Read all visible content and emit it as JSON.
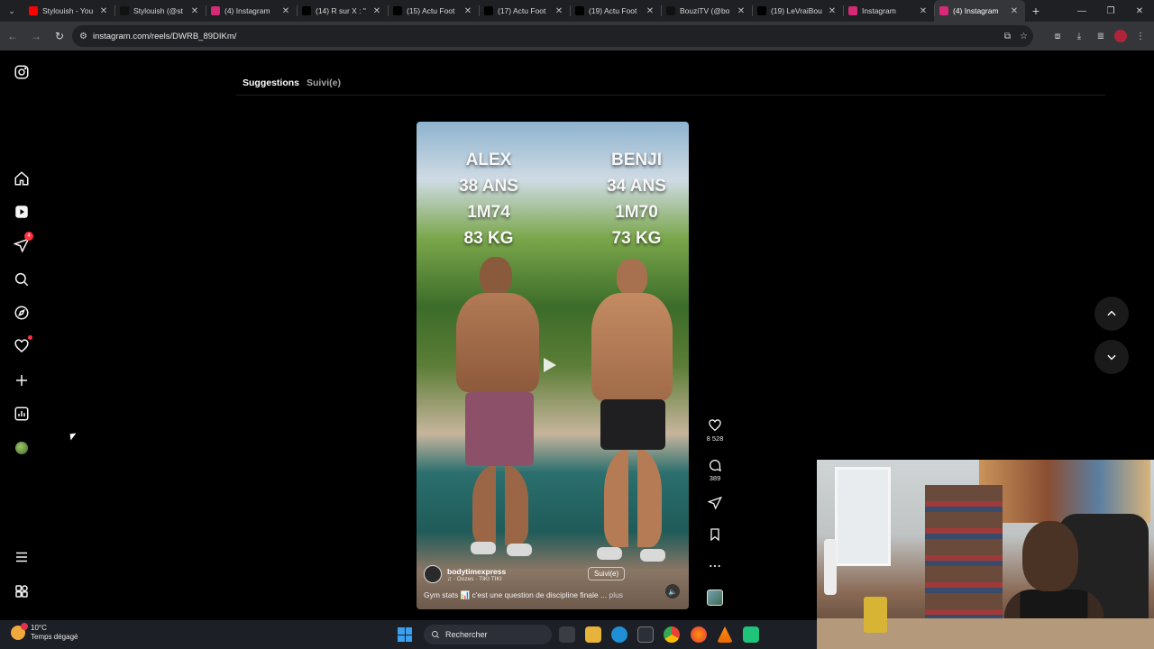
{
  "browser": {
    "tabs": [
      {
        "title": "Stylouish - You",
        "icon": "youtube-icon",
        "color": "#ff0000"
      },
      {
        "title": "Stylouish (@st",
        "icon": "tiktok-icon",
        "color": "#111111"
      },
      {
        "title": "(4) Instagram",
        "icon": "instagram-icon",
        "color": "#d62976"
      },
      {
        "title": "(14) R sur X : \"",
        "icon": "x-icon",
        "color": "#000000"
      },
      {
        "title": "(15) Actu Foot",
        "icon": "x-icon",
        "color": "#000000"
      },
      {
        "title": "(17) Actu Foot",
        "icon": "x-icon",
        "color": "#000000"
      },
      {
        "title": "(19) Actu Foot",
        "icon": "x-icon",
        "color": "#000000"
      },
      {
        "title": "BouziTV (@bo",
        "icon": "tiktok-icon",
        "color": "#111111"
      },
      {
        "title": "(19) LeVraiBou",
        "icon": "x-icon",
        "color": "#000000"
      },
      {
        "title": "Instagram",
        "icon": "instagram-icon",
        "color": "#d62976"
      },
      {
        "title": "(4) Instagram",
        "icon": "instagram-icon",
        "color": "#d62976",
        "active": true
      }
    ],
    "url": "instagram.com/reels/DWRB_89DIKm/"
  },
  "sidebar": {
    "notification_count": "4"
  },
  "feed_tabs": {
    "suggestions": "Suggestions",
    "following": "Suivi(e)"
  },
  "reel": {
    "left_person": {
      "name": "ALEX",
      "age": "38 ANS",
      "height": "1M74",
      "weight": "83 KG"
    },
    "right_person": {
      "name": "BENJI",
      "age": "34 ANS",
      "height": "1M70",
      "weight": "73 KG"
    },
    "username": "bodytimexpress",
    "audio": "♫ · Oozes · TIKI TIKI",
    "follow_label": "Suivi(e)",
    "caption": "Gym stats 📊 c'est une question de discipline finale ...",
    "caption_more": "plus",
    "likes": "8 528",
    "comments": "389"
  },
  "taskbar": {
    "temperature": "10°C",
    "weather": "Temps dégagé",
    "search_placeholder": "Rechercher"
  },
  "colors": {
    "accent_red": "#ff3040",
    "background": "#000000",
    "chrome_tab_bar": "#1f2023",
    "chrome_toolbar": "#35363a"
  }
}
